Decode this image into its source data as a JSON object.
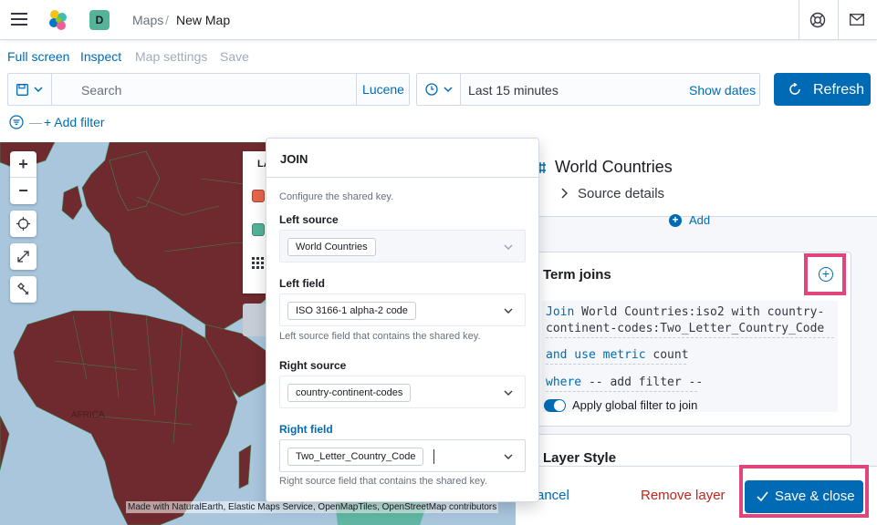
{
  "header": {
    "space_initial": "D",
    "breadcrumbs": [
      "Maps",
      "New Map"
    ],
    "breadcrumb_separator": "/"
  },
  "top_nav": {
    "full_screen": "Full screen",
    "inspect": "Inspect",
    "map_settings": "Map settings",
    "save": "Save"
  },
  "query_bar": {
    "search_placeholder": "Search",
    "language": "Lucene",
    "time_range": "Last 15 minutes",
    "show_dates": "Show dates",
    "refresh": "Refresh"
  },
  "filters": {
    "add_filter": "+ Add filter"
  },
  "map": {
    "zoom_in": "+",
    "zoom_out": "−",
    "legend_label": "LA",
    "africa_label": "AFRICA",
    "attribution": "Made with NaturalEarth, Elastic Maps Service, OpenMapTiles, OpenStreetMap contributors",
    "country_color": "#6e2a2e",
    "water_color": "#a9c6dd"
  },
  "join_popover": {
    "title": "JOIN",
    "description": "Configure the shared key.",
    "left_source_label": "Left source",
    "left_source_value": "World Countries",
    "left_field_label": "Left field",
    "left_field_value": "ISO 3166-1 alpha-2 code",
    "left_field_help": "Left source field that contains the shared key.",
    "right_source_label": "Right source",
    "right_source_value": "country-continent-codes",
    "right_field_label": "Right field",
    "right_field_value": "Two_Letter_Country_Code",
    "right_field_help": "Right source field that contains the shared key."
  },
  "layer_panel": {
    "layer_title": "World Countries",
    "source_details": "Source details",
    "add": "Add",
    "term_joins_title": "Term joins",
    "join_kw": "Join",
    "join_left": "World Countries:iso2",
    "join_with": "with",
    "join_right_1": "country-",
    "join_right_2": "continent-codes:Two_Letter_Country_Code",
    "and_use_metric": "and use metric",
    "metric": "count",
    "where": "where",
    "add_filter": "-- add filter --",
    "apply_global": "Apply global filter to join",
    "layer_style": "Layer Style"
  },
  "footer": {
    "cancel": "ancel",
    "remove_layer": "Remove layer",
    "save_close": "Save & close"
  },
  "colors": {
    "primary": "#006bb4",
    "danger": "#bd271e",
    "highlight": "#e0457b"
  }
}
